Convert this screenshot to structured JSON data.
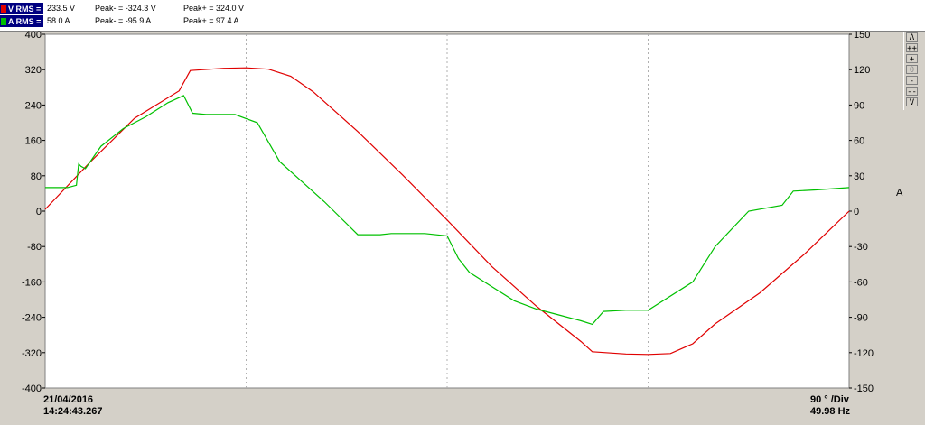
{
  "legend": {
    "voltage": {
      "tag": "V RMS =",
      "rms": "233.5 V",
      "peak_neg": "Peak- = -324.3 V",
      "peak_pos": "Peak+ = 324.0 V",
      "color": "#e00000"
    },
    "current": {
      "tag": "A RMS =",
      "rms": "58.0 A",
      "peak_neg": "Peak- = -95.9 A",
      "peak_pos": "Peak+ = 97.4 A",
      "color": "#00c000"
    }
  },
  "footer": {
    "date": "21/04/2016",
    "time": "14:24:43.267",
    "div": "90 ° /Div",
    "freq": "49.98 Hz"
  },
  "side_buttons": [
    "Λ",
    "++",
    "+",
    "0",
    "-",
    "--",
    "V"
  ],
  "icons": {
    "zoom_buttons": "zoom-control-icons"
  },
  "colors": {
    "plot_bg": "#ffffff",
    "grid": "#b0b0b0",
    "frame_bg": "#d4d0c8"
  },
  "chart_data": {
    "type": "line",
    "title": "",
    "x_unit": "degrees",
    "x_division": "90 ° /Div",
    "xlim": [
      0,
      360
    ],
    "y_left": {
      "label": "",
      "lim": [
        -400,
        400
      ],
      "ticks": [
        "400",
        "320",
        "240",
        "160",
        "80",
        "0",
        "-80",
        "-160",
        "-240",
        "-320",
        "-400"
      ]
    },
    "y_right": {
      "label": "A",
      "lim": [
        -150,
        150
      ],
      "ticks": [
        "150",
        "120",
        "90",
        "60",
        "30",
        "0",
        "-30",
        "-60",
        "-90",
        "-120",
        "-150"
      ]
    },
    "grid": true,
    "series": [
      {
        "name": "V",
        "axis": "left",
        "color": "#e00000",
        "x": [
          0,
          20,
          40,
          60,
          65,
          80,
          90,
          100,
          110,
          120,
          140,
          160,
          180,
          200,
          220,
          240,
          245,
          260,
          270,
          280,
          290,
          300,
          320,
          340,
          360
        ],
        "y": [
          4,
          110,
          210,
          272,
          318,
          323,
          324,
          321,
          305,
          270,
          180,
          82,
          -20,
          -125,
          -215,
          -295,
          -318,
          -323,
          -324,
          -322,
          -300,
          -255,
          -185,
          -97,
          0
        ]
      },
      {
        "name": "A",
        "axis": "right",
        "color": "#00c000",
        "x": [
          0,
          10,
          14,
          15,
          16,
          18,
          25,
          35,
          45,
          55,
          62,
          66,
          72,
          85,
          95,
          105,
          115,
          125,
          140,
          150,
          155,
          160,
          170,
          180,
          185,
          190,
          200,
          210,
          220,
          230,
          240,
          245,
          250,
          260,
          270,
          290,
          300,
          315,
          330,
          335,
          345,
          360
        ],
        "y": [
          20,
          20,
          22,
          40,
          38,
          36,
          55,
          70,
          80,
          92,
          98,
          83,
          82,
          82,
          75,
          42,
          25,
          8,
          -20,
          -20,
          -19,
          -19,
          -19,
          -21,
          -40,
          -52,
          -64,
          -76,
          -83,
          -88,
          -93,
          -96,
          -85,
          -84,
          -84,
          -60,
          -30,
          0,
          5,
          17,
          18,
          20
        ]
      }
    ]
  }
}
